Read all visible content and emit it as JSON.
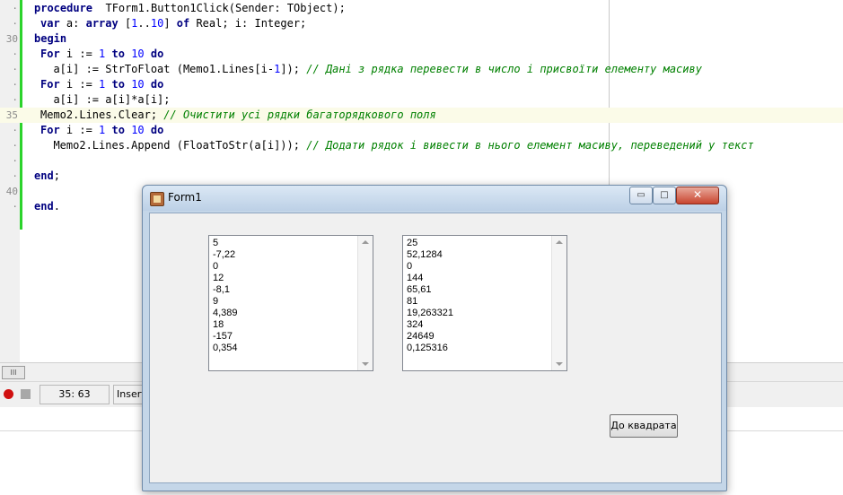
{
  "editor": {
    "lines": [
      {
        "ln": "",
        "parts": [
          [
            "kw",
            "procedure"
          ],
          [
            "",
            "  TForm1.Button1Click(Sender: TObject);"
          ]
        ]
      },
      {
        "ln": "",
        "parts": [
          [
            "",
            ""
          ],
          [
            "kw",
            "var"
          ],
          [
            "",
            " a: "
          ],
          [
            "kw",
            "array"
          ],
          [
            "",
            " ["
          ],
          [
            "num",
            "1"
          ],
          [
            "",
            ".."
          ],
          [
            "num",
            "10"
          ],
          [
            "",
            "] "
          ],
          [
            "kw",
            "of"
          ],
          [
            "",
            " Real; i: Integer;"
          ]
        ]
      },
      {
        "ln": "30",
        "parts": [
          [
            "kw",
            "begin"
          ]
        ]
      },
      {
        "ln": "",
        "parts": [
          [
            "",
            ""
          ],
          [
            "kw",
            "For"
          ],
          [
            "",
            " i := "
          ],
          [
            "num",
            "1"
          ],
          [
            "",
            ""
          ],
          [
            "kw",
            " to "
          ],
          [
            "num",
            "10"
          ],
          [
            "kw",
            " do"
          ]
        ]
      },
      {
        "ln": "",
        "parts": [
          [
            "",
            "  a[i] := StrToFloat (Memo1.Lines[i-"
          ],
          [
            "num",
            "1"
          ],
          [
            "",
            "]); "
          ],
          [
            "cm",
            "// Дані з рядка перевести в число і присвоїти елементу масиву"
          ]
        ]
      },
      {
        "ln": "",
        "parts": [
          [
            "",
            ""
          ],
          [
            "kw",
            "For"
          ],
          [
            "",
            " i := "
          ],
          [
            "num",
            "1"
          ],
          [
            "kw",
            " to "
          ],
          [
            "num",
            "10"
          ],
          [
            "kw",
            " do"
          ]
        ]
      },
      {
        "ln": "",
        "parts": [
          [
            "",
            "  a[i] := a[i]*a[i];"
          ]
        ]
      },
      {
        "ln": "35",
        "parts": [
          [
            "",
            "Memo2.Lines.Clear; "
          ],
          [
            "cm",
            "// Очистити усі рядки багаторядкового поля"
          ]
        ]
      },
      {
        "ln": "",
        "parts": [
          [
            "",
            ""
          ],
          [
            "kw",
            "For"
          ],
          [
            "",
            " i := "
          ],
          [
            "num",
            "1"
          ],
          [
            "kw",
            " to "
          ],
          [
            "num",
            "10"
          ],
          [
            "kw",
            " do"
          ]
        ]
      },
      {
        "ln": "",
        "parts": [
          [
            "",
            "  Memo2.Lines.Append (FloatToStr(a[i])); "
          ],
          [
            "cm",
            "// Додати рядок і вивести в нього елемент масиву, переведений у текст"
          ]
        ]
      },
      {
        "ln": "",
        "parts": []
      },
      {
        "ln": "",
        "parts": [
          [
            "kw",
            "end"
          ],
          [
            "",
            ";"
          ]
        ]
      },
      {
        "ln": "40",
        "parts": []
      },
      {
        "ln": "",
        "parts": [
          [
            "kw",
            "end"
          ],
          [
            "",
            "."
          ]
        ]
      }
    ],
    "dots": [
      "-",
      "-",
      "",
      "-",
      "-",
      "-",
      "-",
      "",
      "-",
      "-",
      "-",
      "-",
      "",
      "-",
      "-"
    ]
  },
  "hscroll": {
    "thumb_label": "III"
  },
  "status": {
    "position": "35: 63",
    "mode": "Insert"
  },
  "form": {
    "title": "Form1",
    "min_glyph": "▭",
    "max_glyph": "□",
    "close_glyph": "✕",
    "memo1": [
      "5",
      "-7,22",
      "0",
      "12",
      "-8,1",
      "9",
      "4,389",
      "18",
      "-157",
      "0,354"
    ],
    "memo2": [
      "25",
      "52,1284",
      "0",
      "144",
      "65,61",
      "81",
      "19,263321",
      "324",
      "24649",
      "0,125316"
    ],
    "button_label": "До квадрата"
  }
}
